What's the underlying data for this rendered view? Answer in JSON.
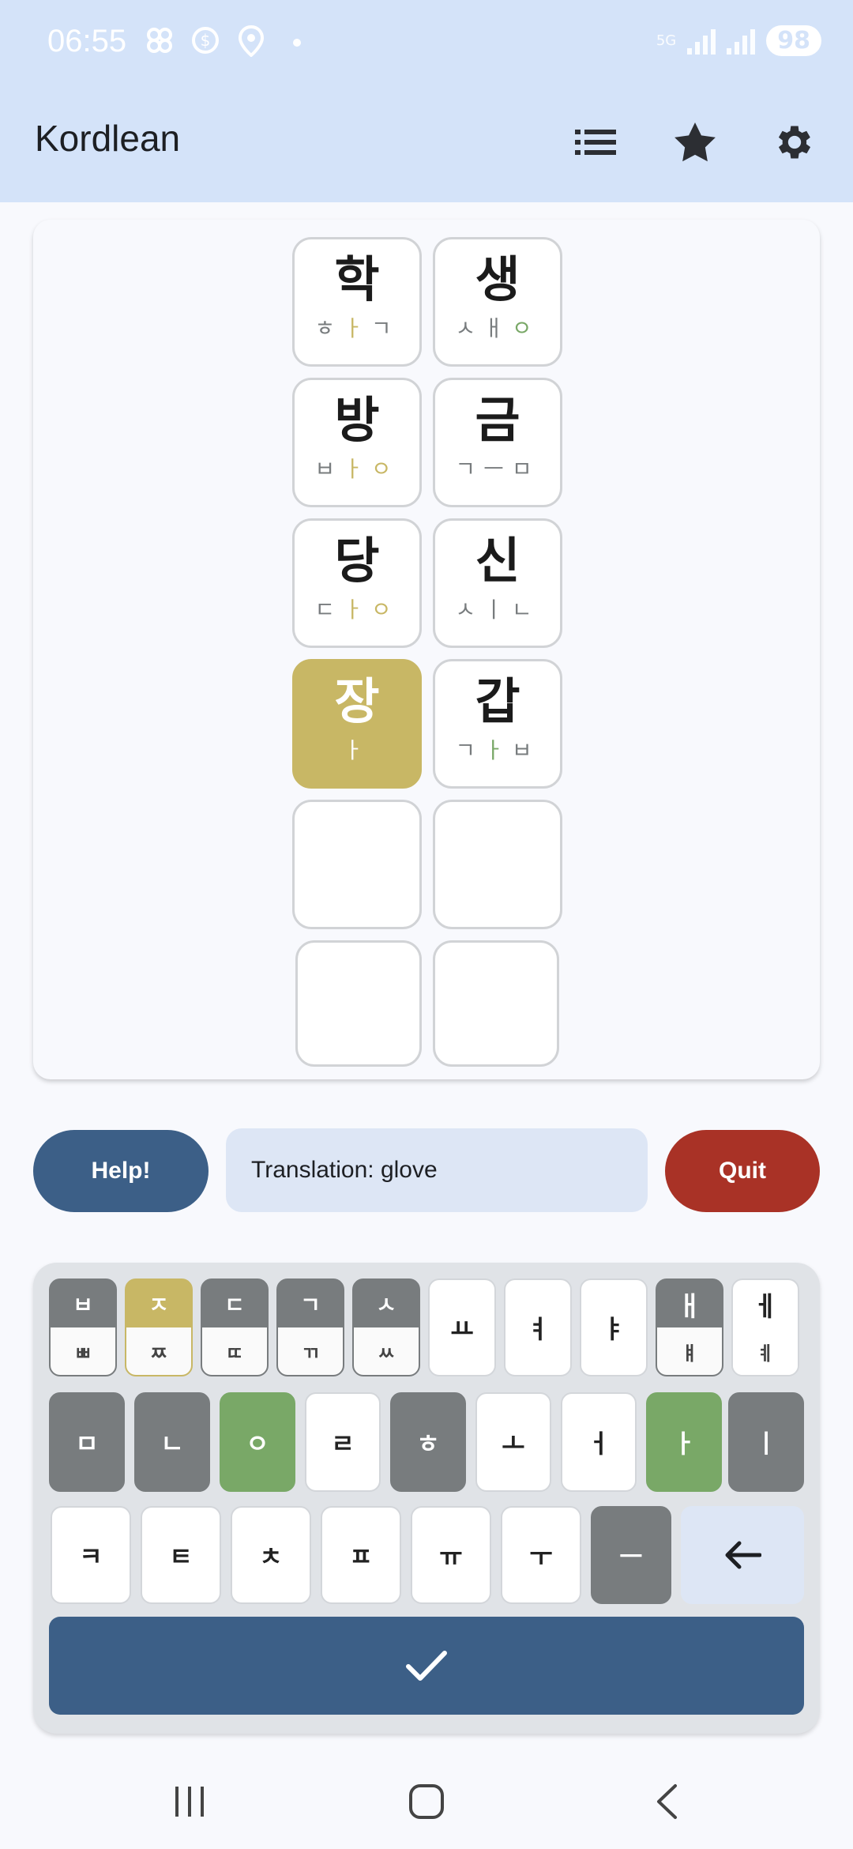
{
  "status_bar": {
    "time": "06:55",
    "network": "5G",
    "battery": "98"
  },
  "app_bar": {
    "title": "Kordlean",
    "actions": [
      "list-icon",
      "star-icon",
      "gear-icon"
    ]
  },
  "board": {
    "rows": [
      [
        {
          "syllable": "학",
          "jamo": "ㅎㅏㄱ",
          "state": "outlined"
        },
        {
          "syllable": "생",
          "jamo": "ㅅㅐㅇ",
          "state": "outlined"
        }
      ],
      [
        {
          "syllable": "방",
          "jamo": "ㅂㅏㅇ",
          "state": "outlined"
        },
        {
          "syllable": "금",
          "jamo": "ㄱㅡㅁ",
          "state": "outlined"
        }
      ],
      [
        {
          "syllable": "당",
          "jamo": "ㄷㅏㅇ",
          "state": "outlined"
        },
        {
          "syllable": "신",
          "jamo": "ㅅㅣㄴ",
          "state": "outlined"
        }
      ],
      [
        {
          "syllable": "장",
          "jamo": "ㅏ",
          "state": "yellow"
        },
        {
          "syllable": "갑",
          "jamo": "ㄱㅏㅂ",
          "state": "outlined"
        }
      ],
      [
        {
          "syllable": "",
          "jamo": "",
          "state": "empty"
        },
        {
          "syllable": "",
          "jamo": "",
          "state": "empty"
        }
      ],
      [
        {
          "syllable": "",
          "jamo": "",
          "state": "empty"
        },
        {
          "syllable": "",
          "jamo": "",
          "state": "empty"
        }
      ]
    ]
  },
  "actions": {
    "help_label": "Help!",
    "translation": "Translation: glove",
    "quit_label": "Quit"
  },
  "keyboard": {
    "row1": [
      {
        "top": "ㅂ",
        "bottom": "ㅃ",
        "state": "gray"
      },
      {
        "top": "ㅈ",
        "bottom": "ㅉ",
        "state": "yellow"
      },
      {
        "top": "ㄷ",
        "bottom": "ㄸ",
        "state": "gray"
      },
      {
        "top": "ㄱ",
        "bottom": "ㄲ",
        "state": "gray"
      },
      {
        "top": "ㅅ",
        "bottom": "ㅆ",
        "state": "gray"
      },
      {
        "top": "ㅛ",
        "bottom": "",
        "state": "white"
      },
      {
        "top": "ㅕ",
        "bottom": "",
        "state": "white"
      },
      {
        "top": "ㅑ",
        "bottom": "",
        "state": "white"
      },
      {
        "top": "ㅐ",
        "bottom": "ㅒ",
        "state": "gray"
      },
      {
        "top": "ㅔ",
        "bottom": "ㅖ",
        "state": "white"
      }
    ],
    "row2": [
      {
        "label": "ㅁ",
        "state": "gray"
      },
      {
        "label": "ㄴ",
        "state": "gray"
      },
      {
        "label": "ㅇ",
        "state": "green"
      },
      {
        "label": "ㄹ",
        "state": "white"
      },
      {
        "label": "ㅎ",
        "state": "gray"
      },
      {
        "label": "ㅗ",
        "state": "white"
      },
      {
        "label": "ㅓ",
        "state": "white"
      },
      {
        "label": "ㅏ",
        "state": "green"
      },
      {
        "label": "ㅣ",
        "state": "gray"
      }
    ],
    "row3": [
      {
        "label": "ㅋ",
        "state": "white"
      },
      {
        "label": "ㅌ",
        "state": "white"
      },
      {
        "label": "ㅊ",
        "state": "white"
      },
      {
        "label": "ㅍ",
        "state": "white"
      },
      {
        "label": "ㅠ",
        "state": "white"
      },
      {
        "label": "ㅜ",
        "state": "white"
      },
      {
        "label": "ㅡ",
        "state": "gray"
      }
    ],
    "backspace_icon": "backspace-arrow-icon",
    "submit_icon": "check-icon"
  },
  "nav_bar": {
    "icons": [
      "recent-apps-icon",
      "home-icon",
      "back-icon"
    ]
  },
  "colors": {
    "yellow": "#c8b765",
    "green": "#79a867",
    "gray": "#787c7e",
    "blue": "#3c5f87",
    "red": "#a93226"
  }
}
